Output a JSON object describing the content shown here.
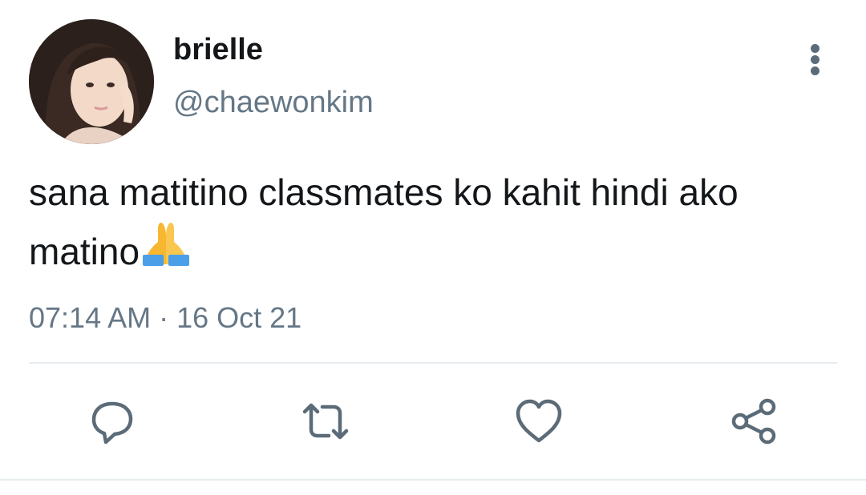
{
  "tweet": {
    "display_name": "brielle",
    "handle": "@chaewonkim",
    "text": "sana matitino classmates ko kahit hindi ako matino",
    "emoji": "folded-hands",
    "time": "07:14 AM",
    "separator": " · ",
    "date": "16 Oct 21"
  },
  "actions": [
    {
      "icon": "reply-icon"
    },
    {
      "icon": "retweet-icon"
    },
    {
      "icon": "like-icon"
    },
    {
      "icon": "share-icon"
    }
  ],
  "colors": {
    "text": "#14171a",
    "secondary": "#657786",
    "icon": "#5b6b78",
    "divider": "#e6ecf0"
  }
}
